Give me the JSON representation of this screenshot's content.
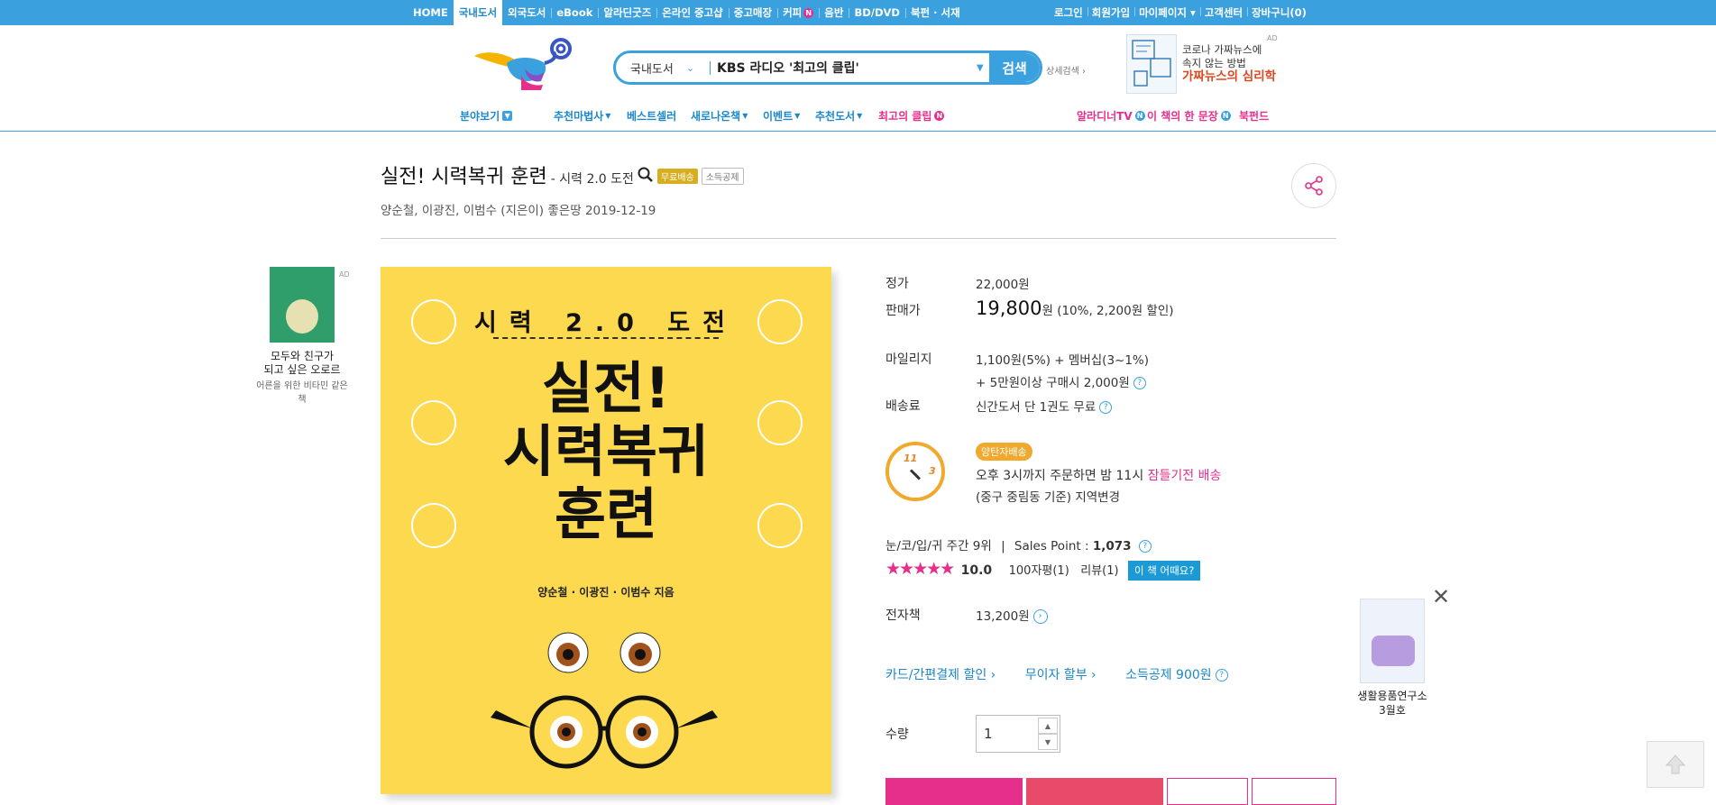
{
  "topnav": {
    "items": [
      "HOME",
      "국내도서",
      "외국도서",
      "eBook",
      "알라딘굿즈",
      "온라인 중고샵",
      "중고매장",
      "커피",
      "음반",
      "BD/DVD",
      "북펀 · 서재"
    ],
    "coffee_badge": "N",
    "util": [
      "로그인",
      "회원가입",
      "마이페이지 ▾",
      "고객센터",
      "장바구니(0)"
    ]
  },
  "search": {
    "category": "국내도서",
    "query": "KBS 라디오 '최고의 클립'",
    "button": "검색",
    "advanced": "상세검색 ›"
  },
  "header_ad": {
    "line1": "코로나 가짜뉴스에",
    "line2": "속지 않는 방법",
    "line3": "가짜뉴스의 심리학",
    "ad_label": "AD"
  },
  "subnav": {
    "browse": "분야보기",
    "items": [
      "추천마법사",
      "베스트셀러",
      "새로나온책",
      "이벤트",
      "추천도서"
    ],
    "clip": "최고의 클립",
    "right": [
      "알라디너TV",
      "이 책의 한 문장",
      "북펀드"
    ],
    "badge_n": "N"
  },
  "product": {
    "title": "실전! 시력복귀 훈련",
    "subtitle": "- 시력 2.0 도전",
    "tag_free": "무료배송",
    "tag_deduct": "소득공제",
    "authors": "양순철,",
    "author2": "이광진,",
    "author3": "이범수 (지은이)",
    "publisher": "좋은땅",
    "date": "2019-12-19"
  },
  "cover": {
    "top": "시력 2.0 도전",
    "title_line1": "실전!",
    "title_line2": "시력복귀",
    "title_line3": "훈련",
    "authors": "양순철 · 이광진 · 이범수 지음"
  },
  "left_ad": {
    "ad_label": "AD",
    "line1": "모두와 친구가",
    "line2": "되고 싶은 오로르",
    "line3": "어른을 위한 비타민 같은 책"
  },
  "info": {
    "list_price_label": "정가",
    "list_price": "22,000원",
    "sale_label": "판매가",
    "sale_price": "19,800",
    "sale_unit": "원",
    "sale_detail": "(10%, 2,200원 할인)",
    "mileage_label": "마일리지",
    "mileage_line1": "1,100원(5%) + 멤버십(3~1%)",
    "mileage_line2": "+ 5만원이상 구매시 2,000원",
    "shipping_label": "배송료",
    "shipping_value": "신간도서 단 1권도 무료",
    "clock_11": "11",
    "clock_3": "3",
    "delivery_badge": "양탄자배송",
    "delivery_line1": "오후 3시까지 주문하면 밤 11시",
    "delivery_link": "잠들기전 배송",
    "delivery_line2": "(중구 중림동 기준) 지역변경",
    "rank": "눈/코/입/귀 주간 9위",
    "divider": "|",
    "sales_point_label": "Sales Point :",
    "sales_point": "1,073",
    "stars": "★★★★★",
    "rating": "10.0",
    "reviews_100": "100자평(1)",
    "reviews": "리뷰(1)",
    "review_btn": "이 책 어때요?",
    "ebook_label": "전자책",
    "ebook_price": "13,200원",
    "links": [
      "카드/간편결제 할인 ›",
      "무이자 할부 ›",
      "소득공제 900원"
    ],
    "qty_label": "수량",
    "qty": "1"
  },
  "right_ad": {
    "line1": "생활용품연구소",
    "line2": "3월호"
  },
  "colors": {
    "brand_blue": "#3aa0de",
    "pink": "#e62e8b",
    "gold": "#d6ae20",
    "cover_yellow": "#fcd94f"
  }
}
